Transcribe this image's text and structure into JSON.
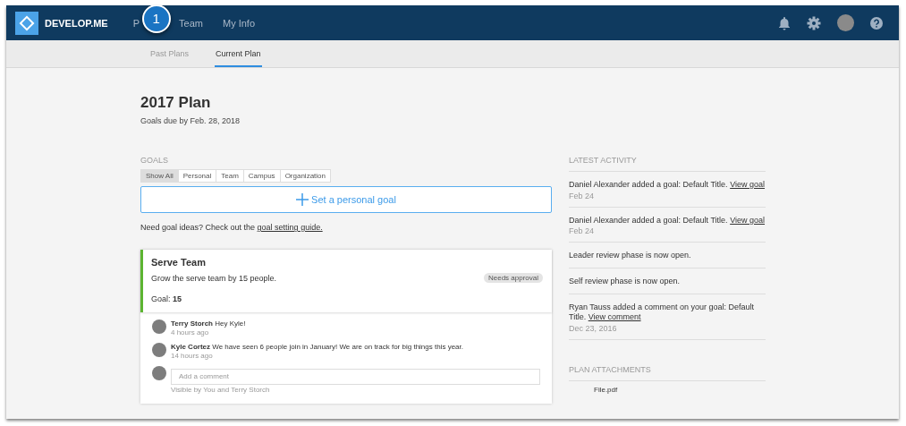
{
  "header": {
    "logo_text": "DEVELOP.ME",
    "nav": [
      {
        "label": "P",
        "selected": false
      },
      {
        "label": "Team",
        "selected": false
      },
      {
        "label": "My Info",
        "selected": false
      }
    ],
    "step_badge": "1"
  },
  "subnav": {
    "tabs": [
      {
        "label": "Past Plans",
        "selected": false
      },
      {
        "label": "Current Plan",
        "selected": true
      }
    ]
  },
  "plan": {
    "title": "2017 Plan",
    "due": "Goals due by Feb. 28, 2018"
  },
  "goals": {
    "heading": "GOALS",
    "filters": [
      {
        "label": "Show All",
        "selected": true
      },
      {
        "label": "Personal",
        "selected": false
      },
      {
        "label": "Team",
        "selected": false
      },
      {
        "label": "Campus",
        "selected": false
      },
      {
        "label": "Organization",
        "selected": false
      }
    ],
    "add_button": "Set a personal goal",
    "hint": "Need goal ideas? Check out the",
    "hint_link": "goal setting guide.",
    "cards": [
      {
        "title": "Serve Team",
        "description": "Grow the serve team by 15 people.",
        "badge": "Needs approval",
        "goal": "Goal: **15**",
        "color": "#5cb531",
        "comments": [
          {
            "author": "Terry Storch",
            "text": "Hey Kyle!",
            "time": "4 hours ago"
          },
          {
            "author": "Kyle Cortez",
            "text": "We have seen 6 people join in January! We are on track for big things this year.",
            "time": "14 hours ago"
          }
        ],
        "comment_placeholder": "Add a comment",
        "visibility": "Visible by You and Terry Storch"
      }
    ]
  },
  "activity": {
    "heading": "LATEST ACTIVITY",
    "items": [
      {
        "text": "Daniel Alexander added a goal: Default Title.",
        "link": "View goal",
        "date": "Feb 24"
      },
      {
        "text": "Daniel Alexander added a goal: Default Title.",
        "link": "View goal",
        "date": "Feb 24"
      },
      {
        "text": "Leader review phase is now open."
      },
      {
        "text": "Self review phase is now open."
      },
      {
        "text": "Ryan Tauss added a comment on your goal: Default Title.",
        "link": "View comment",
        "date": "Dec 23, 2016"
      }
    ]
  },
  "attachments": {
    "heading": "PLAN ATTACHMENTS",
    "files": [
      "File.pdf"
    ]
  }
}
